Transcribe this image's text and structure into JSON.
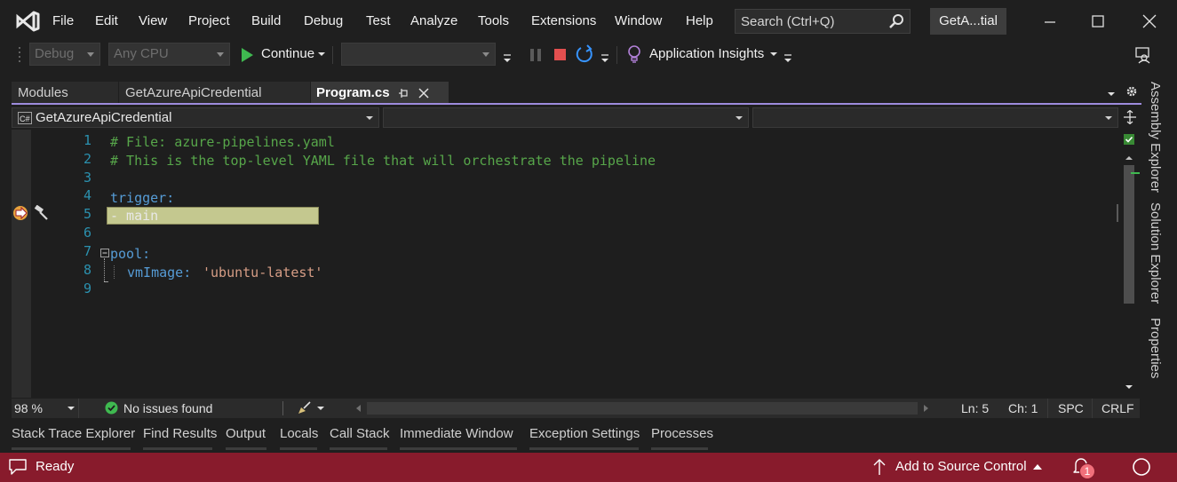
{
  "menu": [
    "File",
    "Edit",
    "View",
    "Project",
    "Build",
    "Debug",
    "Test",
    "Analyze",
    "Tools",
    "Extensions",
    "Window",
    "Help"
  ],
  "search": {
    "placeholder": "Search (Ctrl+Q)"
  },
  "solution_badge": "GetA...tial",
  "toolbar": {
    "config": "Debug",
    "platform": "Any CPU",
    "continue_label": "Continue",
    "insights_label": "Application Insights",
    "colors": {
      "play": "#3fb950",
      "stop": "#e34f4f",
      "restart": "#3794ff",
      "insights": "#b180d7"
    }
  },
  "tabs": [
    {
      "label": "Modules"
    },
    {
      "label": "GetAzureApiCredential"
    },
    {
      "label": "Program.cs",
      "active": true
    }
  ],
  "navbar": {
    "project": "GetAzureApiCredential",
    "type_scope": "",
    "member_scope": ""
  },
  "editor": {
    "lines": [
      {
        "num": "1",
        "text": "# File: azure-pipelines.yaml"
      },
      {
        "num": "2",
        "text": "# This is the top-level YAML file that will orchestrate the pipeline"
      },
      {
        "num": "3",
        "text": ""
      },
      {
        "num": "4",
        "key": "trigger:"
      },
      {
        "num": "5",
        "current": "- main"
      },
      {
        "num": "6",
        "text": ""
      },
      {
        "num": "7",
        "key": "pool:"
      },
      {
        "num": "8",
        "key": "vmImage:",
        "value": "'ubuntu-latest'"
      },
      {
        "num": "9",
        "text": ""
      }
    ],
    "colors": {
      "comment": "#57a64a",
      "keyword": "#569cd6",
      "string": "#d69d85",
      "current_statement": "#c4c88f"
    }
  },
  "editor_status": {
    "zoom": "98 %",
    "issues": "No issues found",
    "line": "Ln: 5",
    "char": "Ch: 1",
    "whitespace": "SPC",
    "line_ending": "CRLF"
  },
  "right_dock": [
    "Assembly Explorer",
    "Solution Explorer",
    "Properties"
  ],
  "bottom_tabs": [
    "Stack Trace Explorer",
    "Find Results",
    "Output",
    "Locals",
    "Call Stack",
    "Immediate Window",
    "Exception Settings",
    "Processes"
  ],
  "status": {
    "ready": "Ready",
    "source_control": "Add to Source Control",
    "notifications": "1",
    "color": "#881b2c"
  }
}
